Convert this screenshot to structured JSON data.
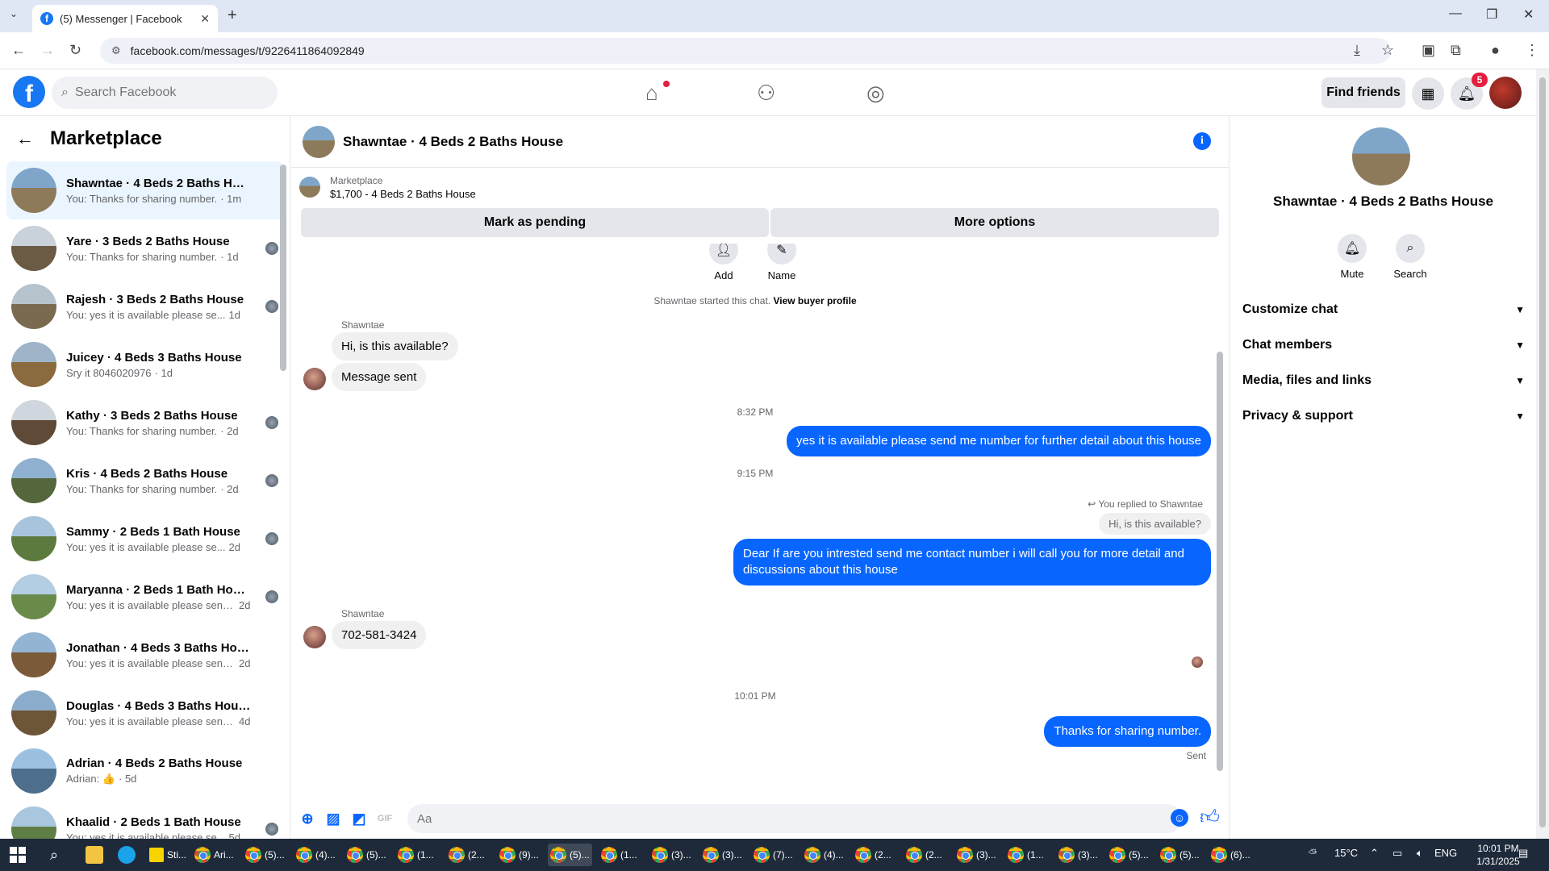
{
  "browser": {
    "tab_title": "(5) Messenger | Facebook",
    "url": "facebook.com/messages/t/9226411864092849"
  },
  "fb": {
    "search_placeholder": "Search Facebook",
    "find_friends": "Find friends",
    "notification_count": "5"
  },
  "sidebar": {
    "title": "Marketplace",
    "conversations": [
      {
        "name": "Shawntae · 4 Beds 2 Baths House",
        "preview": "You: Thanks for sharing number.",
        "time": "· 1m",
        "active": true
      },
      {
        "name": "Yare · 3 Beds 2 Baths House",
        "preview": "You: Thanks for sharing number.",
        "time": "· 1d"
      },
      {
        "name": "Rajesh · 3 Beds 2 Baths House",
        "preview": "You: yes it is available please se...",
        "time": "1d"
      },
      {
        "name": "Juicey · 4 Beds 3 Baths House",
        "preview": "Sry it 8046020976",
        "time": "· 1d"
      },
      {
        "name": "Kathy · 3 Beds 2 Baths House",
        "preview": "You: Thanks for sharing number.",
        "time": "· 2d"
      },
      {
        "name": "Kris · 4 Beds 2 Baths House",
        "preview": "You: Thanks for sharing number.",
        "time": "· 2d"
      },
      {
        "name": "Sammy · 2 Beds 1 Bath House",
        "preview": "You: yes it is available please se...",
        "time": "2d"
      },
      {
        "name": "Maryanna · 2 Beds 1 Bath House",
        "preview": "You: yes it is available please send ...",
        "time": "2d"
      },
      {
        "name": "Jonathan · 4 Beds 3 Baths House",
        "preview": "You: yes it is available please send ...",
        "time": "2d"
      },
      {
        "name": "Douglas · 4 Beds 3 Baths House",
        "preview": "You: yes it is available please send ...",
        "time": "4d"
      },
      {
        "name": "Adrian · 4 Beds 2 Baths House",
        "preview": "Adrian: 👍",
        "time": "· 5d"
      },
      {
        "name": "Khaalid · 2 Beds 1 Bath House",
        "preview": "You: yes it is available please se...",
        "time": "5d"
      }
    ]
  },
  "chat": {
    "title": "Shawntae · 4 Beds 2 Baths House",
    "marketplace_label": "Marketplace",
    "listing": "$1,700 - 4 Beds 2 Baths House",
    "mark_pending": "Mark as pending",
    "more_options": "More options",
    "quick_add": "Add",
    "quick_name": "Name",
    "started_text": "Shawntae started this chat.",
    "view_profile": "View buyer profile",
    "sender": "Shawntae",
    "msg1": "Hi, is this available?",
    "msg2": "Message sent",
    "time1": "8:32 PM",
    "out1": "yes it is available please send me number for further detail about this house",
    "time2": "9:15 PM",
    "reply_note": "You replied to Shawntae",
    "reply_quote": "Hi, is this available?",
    "out2": "Dear    If are you intrested  send me contact number  i will call you for more detail and discussions about this house",
    "sender2": "Shawntae",
    "msg3": "702-581-3424",
    "time3": "10:01 PM",
    "out3": "Thanks for sharing number.",
    "sent_label": "Sent",
    "composer_placeholder": "Aa"
  },
  "right_panel": {
    "name": "Shawntae · 4 Beds 2 Baths House",
    "mute": "Mute",
    "search": "Search",
    "sections": [
      "Customize chat",
      "Chat members",
      "Media, files and links",
      "Privacy & support"
    ]
  },
  "taskbar": {
    "apps": [
      "Sti...",
      "Ari...",
      "(5)...",
      "(4)...",
      "(5)...",
      "(1...",
      "(2...",
      "(9)...",
      "(5)...",
      "(1...",
      "(3)...",
      "(3)...",
      "(7)...",
      "(4)...",
      "(2...",
      "(2...",
      "(3)...",
      "(1...",
      "(3)...",
      "(5)...",
      "(5)...",
      "(6)..."
    ],
    "weather": "15°C",
    "lang": "ENG",
    "time": "10:01 PM",
    "date": "1/31/2025"
  },
  "colors": {
    "fb_blue": "#1877f2",
    "outgoing_bubble": "#0866ff",
    "active_conversation": "#ebf5ff",
    "notification_red": "#e41e3f"
  }
}
